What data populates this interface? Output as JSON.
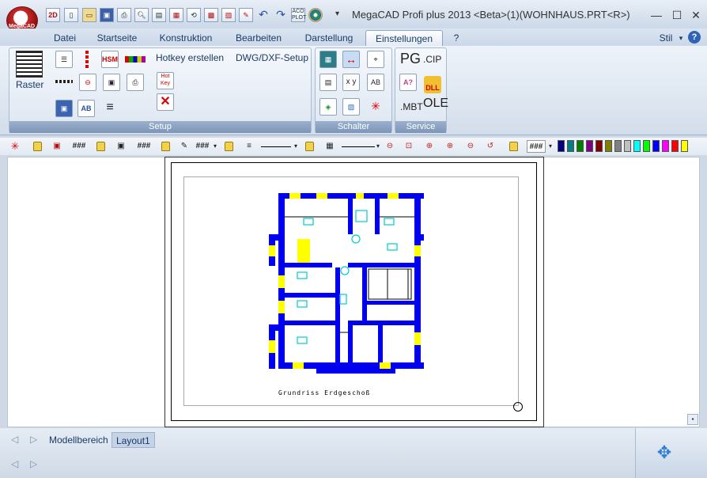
{
  "app": {
    "title": "MegaCAD Profi plus 2013 <Beta>(1)(WOHNHAUS.PRT<R>)",
    "logo_text": "MegaCAD",
    "quick_access": [
      "2D/3D",
      "new",
      "open",
      "save",
      "print",
      "preview",
      "print2",
      "layout",
      "save-as",
      "undo-x",
      "redo",
      "undo",
      "acplot",
      "media"
    ]
  },
  "menu": {
    "tabs": [
      "Datei",
      "Startseite",
      "Konstruktion",
      "Bearbeiten",
      "Darstellung",
      "Einstellungen",
      "?"
    ],
    "active_tab": "Einstellungen",
    "style_label": "Stil"
  },
  "ribbon": {
    "setup": {
      "label": "Setup",
      "raster_label": "Raster",
      "hotkey_label": "Hotkey erstellen",
      "dwg_label": "DWG/DXF-Setup",
      "hotkey_icon_text": "Hot Key"
    },
    "schalter": {
      "label": "Schalter"
    },
    "service": {
      "label": "Service",
      "pg_label": "PG",
      "cip_label": ".CIP",
      "dll_label": "DLL",
      "mbt_label": ".MBT",
      "ole_label": "OLE"
    }
  },
  "toolbar": {
    "hash1": "###",
    "hash2": "###",
    "hash3": "###",
    "hash4": "###",
    "colors": [
      "#000080",
      "#008080",
      "#008000",
      "#800080",
      "#800000",
      "#808000",
      "#808080",
      "#c0c0c0",
      "#00ffff",
      "#00ff00",
      "#0000ff",
      "#ff00ff",
      "#ff0000",
      "#ffff00"
    ]
  },
  "drawing": {
    "plan_title": "Grundriss Erdgeschoß"
  },
  "statusbar": {
    "tab_model": "Modellbereich",
    "tab_layout": "Layout1"
  }
}
